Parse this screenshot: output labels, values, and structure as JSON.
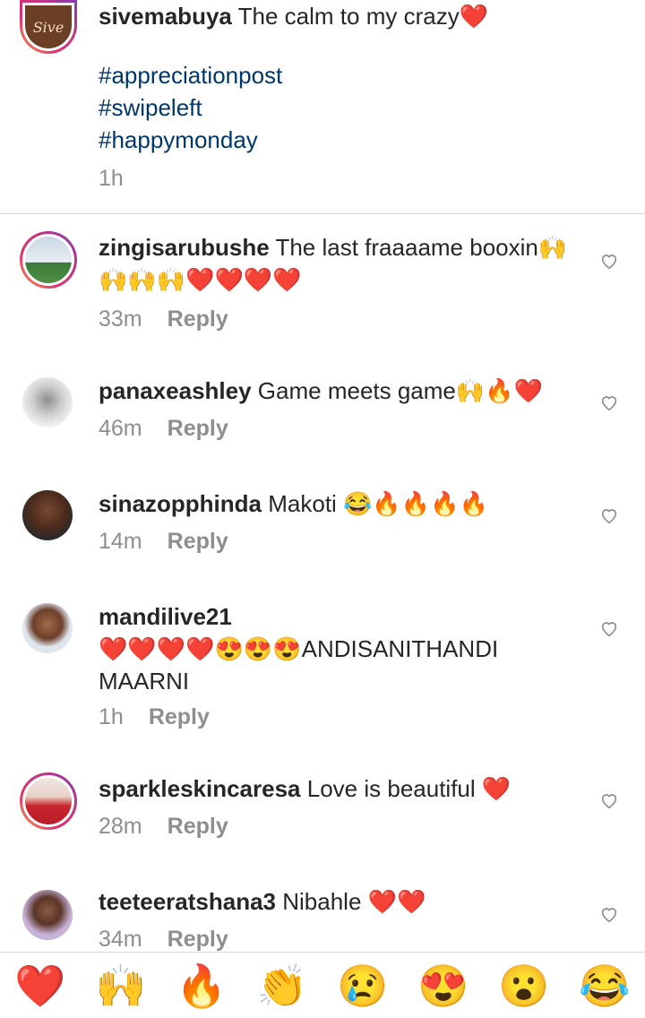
{
  "caption": {
    "username": "sivemabuya",
    "text": "The calm to my crazy",
    "emoji": "❤️",
    "hashtags": [
      "#appreciationpost",
      "#swipeleft",
      "#happymonday"
    ],
    "time": "1h",
    "avatar_logo_text": "Sive"
  },
  "reply_label": "Reply",
  "comments": [
    {
      "username": "zingisarubushe",
      "text": "The last fraaaame booxin🙌🙌🙌🙌❤️❤️❤️❤️",
      "time": "33m"
    },
    {
      "username": "panaxeashley",
      "text": "Game meets game🙌🔥❤️",
      "time": "46m"
    },
    {
      "username": "sinazopphinda",
      "text": "Makoti 😂🔥🔥🔥🔥",
      "time": "14m"
    },
    {
      "username": "mandilive21",
      "text": "❤️❤️❤️❤️😍😍😍ANDISANITHANDI MAARNI",
      "time": "1h"
    },
    {
      "username": "sparkleskincaresa",
      "text": "Love is beautiful ❤️",
      "time": "28m"
    },
    {
      "username": "teeteeratshana3",
      "text": "Nibahle ❤️❤️",
      "time": "34m"
    }
  ],
  "reactions": [
    "❤️",
    "🙌",
    "🔥",
    "👏",
    "😢",
    "😍",
    "😮",
    "😂"
  ]
}
